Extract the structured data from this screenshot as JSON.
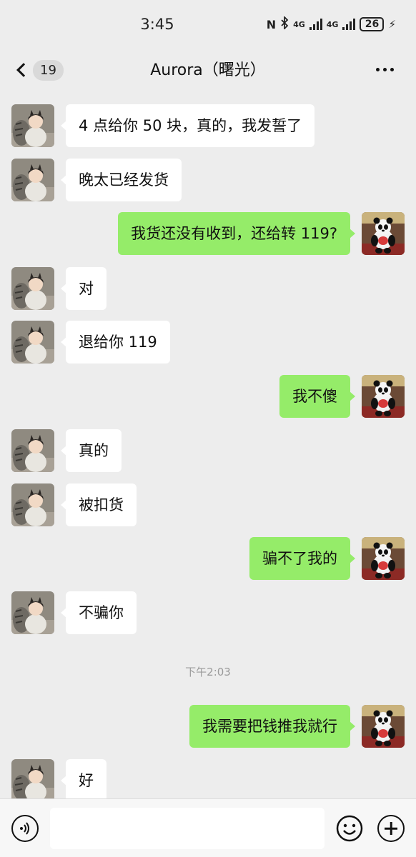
{
  "status_bar": {
    "time": "3:45",
    "nfc": "N",
    "net_a": "4G",
    "net_b": "4G",
    "battery": "26",
    "icons": [
      "nfc-icon",
      "bluetooth-icon",
      "signal-icon",
      "signal-icon",
      "battery-icon",
      "charging-icon"
    ]
  },
  "header": {
    "back_count": "19",
    "title": "Aurora（曙光）",
    "icons": [
      "back-chevron-icon",
      "more-icon"
    ]
  },
  "messages": [
    {
      "side": "left",
      "text": "4 点给你 50 块，真的，我发誓了"
    },
    {
      "side": "left",
      "text": "晚太已经发货"
    },
    {
      "side": "right",
      "text": "我货还没有收到，还给转 119?"
    },
    {
      "side": "left",
      "text": "对"
    },
    {
      "side": "left",
      "text": "退给你 119"
    },
    {
      "side": "right",
      "text": "我不傻"
    },
    {
      "side": "left",
      "text": "真的"
    },
    {
      "side": "left",
      "text": "被扣货"
    },
    {
      "side": "right",
      "text": "骗不了我的"
    },
    {
      "side": "left",
      "text": "不骗你"
    },
    {
      "side": "right",
      "text": "我需要把钱推我就行"
    },
    {
      "side": "left",
      "text": "好"
    }
  ],
  "time_divider": "下午2:03",
  "input_bar": {
    "text_value": "",
    "icons": [
      "voice-icon",
      "emoji-icon",
      "plus-icon"
    ]
  },
  "colors": {
    "background": "#ededed",
    "bubble_sent": "#95ec69",
    "bubble_received": "#ffffff",
    "timestamp": "#9a9a9a"
  }
}
